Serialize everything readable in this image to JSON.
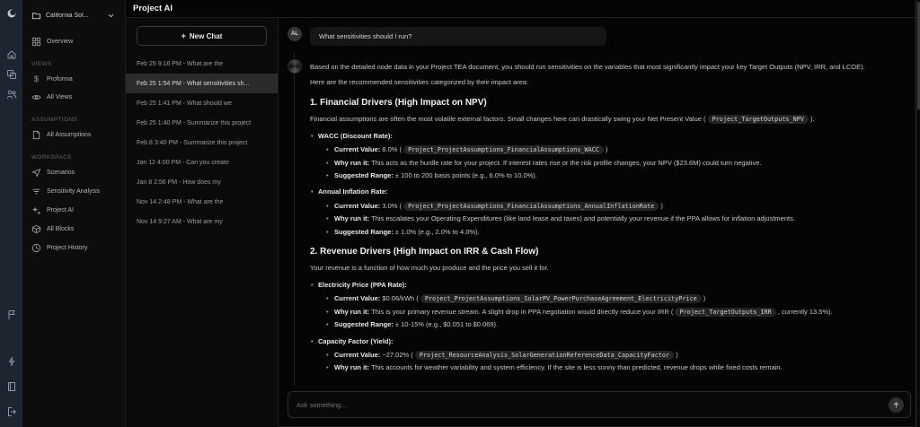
{
  "colors": {
    "rail_bg": "#1d2531",
    "selected_item_bg": "#2b2b2b",
    "chip_bg": "#242424",
    "panel_bg": "#0d0d0d"
  },
  "rail": {
    "top_icons": [
      "logo-icon",
      "home-icon",
      "copy-icon",
      "users-icon"
    ],
    "bottom_icons": [
      "flag-icon",
      "zap-icon",
      "book-icon",
      "logout-icon"
    ]
  },
  "sidebar": {
    "project": {
      "label": "California Sol...",
      "icon": "folder-icon",
      "chevron": "chevron-down-icon"
    },
    "groups": [
      {
        "section": "",
        "items": [
          {
            "label": "Overview",
            "icon": "grid-icon"
          }
        ]
      },
      {
        "section": "VIEWS",
        "items": [
          {
            "label": "Proforma",
            "icon": "dollar-icon"
          },
          {
            "label": "All Views",
            "icon": "eye-icon"
          }
        ]
      },
      {
        "section": "ASSUMPTIONS",
        "items": [
          {
            "label": "All Assumptions",
            "icon": "file-icon"
          }
        ]
      },
      {
        "section": "WORKSPACE",
        "items": [
          {
            "label": "Scenarios",
            "icon": "scenarios-icon"
          },
          {
            "label": "Sensitivity Analysis",
            "icon": "filter-icon"
          },
          {
            "label": "Project AI",
            "icon": "sparkles-icon"
          },
          {
            "label": "All Blocks",
            "icon": "blocks-icon"
          },
          {
            "label": "Project History",
            "icon": "clock-icon"
          }
        ]
      }
    ]
  },
  "header": {
    "title": "Project AI"
  },
  "chat_list": {
    "new_chat": {
      "icon": "plus-icon",
      "label": "New Chat"
    },
    "items": [
      {
        "label": "Feb 25 9:16 PM - What are the",
        "selected": false
      },
      {
        "label": "Feb 25 1:54 PM - What sensitivities sh...",
        "selected": true
      },
      {
        "label": "Feb 25 1:41 PM - What should we",
        "selected": false
      },
      {
        "label": "Feb 25 1:40 PM - Summarize this project",
        "selected": false
      },
      {
        "label": "Feb 8 3:40 PM - Summarize this project",
        "selected": false
      },
      {
        "label": "Jan 12 4:00 PM - Can you create",
        "selected": false
      },
      {
        "label": "Jan 8 2:56 PM - How does my",
        "selected": false
      },
      {
        "label": "Nov 14 2:48 PM - What are the",
        "selected": false
      },
      {
        "label": "Nov 14 9:27 AM - What are my",
        "selected": false
      }
    ]
  },
  "conversation": {
    "user": {
      "avatar_initials": "AL",
      "message": "What sensitivities should I run?"
    },
    "assistant": {
      "blocks": [
        {
          "type": "p",
          "runs": [
            {
              "t": "Based on the detailed node data in your Project TEA document, you should run sensitivities on the variables that most significantly impact your key Target Outputs (NPV, IRR, and LCOE)."
            }
          ]
        },
        {
          "type": "p",
          "runs": [
            {
              "t": "Here are the recommended sensitivities categorized by their impact area:"
            }
          ]
        },
        {
          "type": "h",
          "runs": [
            {
              "t": "1. Financial Drivers (High Impact on NPV)"
            }
          ]
        },
        {
          "type": "p",
          "runs": [
            {
              "t": "Financial assumptions are often the most volatile external factors. Small changes here can drastically swing your Net Present Value ( "
            },
            {
              "c": "Project_TargetOutputs_NPV"
            },
            {
              "t": " )."
            }
          ]
        },
        {
          "type": "li1",
          "runs": [
            {
              "b": "WACC (Discount Rate):"
            }
          ]
        },
        {
          "type": "li2",
          "runs": [
            {
              "b": "Current Value:"
            },
            {
              "t": " 8.0% ( "
            },
            {
              "c": "Project_ProjectAssumptions_FinancialAssumptions_WACC"
            },
            {
              "t": " )"
            }
          ]
        },
        {
          "type": "li2",
          "runs": [
            {
              "b": "Why run it:"
            },
            {
              "t": " This acts as the hurdle rate for your project. If interest rates rise or the risk profile changes, your NPV ($23.6M) could turn negative."
            }
          ]
        },
        {
          "type": "li2",
          "runs": [
            {
              "b": "Suggested Range:"
            },
            {
              "t": " ± 100 to 200 basis points (e.g., 6.0% to 10.0%)."
            }
          ]
        },
        {
          "type": "li1",
          "runs": [
            {
              "b": "Annual Inflation Rate:"
            }
          ]
        },
        {
          "type": "li2",
          "runs": [
            {
              "b": "Current Value:"
            },
            {
              "t": " 3.0% ( "
            },
            {
              "c": "Project_ProjectAssumptions_FinancialAssumptions_AnnualInflationRate"
            },
            {
              "t": " )"
            }
          ]
        },
        {
          "type": "li2",
          "runs": [
            {
              "b": "Why run it:"
            },
            {
              "t": " This escalates your Operating Expenditures (like land lease and taxes) and potentially your revenue if the PPA allows for inflation adjustments."
            }
          ]
        },
        {
          "type": "li2",
          "runs": [
            {
              "b": "Suggested Range:"
            },
            {
              "t": " ± 1.0% (e.g., 2.0% to 4.0%)."
            }
          ]
        },
        {
          "type": "h",
          "runs": [
            {
              "t": "2. Revenue Drivers (High Impact on IRR & Cash Flow)"
            }
          ]
        },
        {
          "type": "p",
          "runs": [
            {
              "t": "Your revenue is a function of how much you produce and the price you sell it for."
            }
          ]
        },
        {
          "type": "li1",
          "runs": [
            {
              "b": "Electricity Price (PPA Rate):"
            }
          ]
        },
        {
          "type": "li2",
          "runs": [
            {
              "b": "Current Value:"
            },
            {
              "t": " $0.06/kWh ( "
            },
            {
              "c": "Project_ProjectAssumptions_SolarPV_PowerPurchaseAgreement_ElectricityPrice"
            },
            {
              "t": " )"
            }
          ]
        },
        {
          "type": "li2",
          "runs": [
            {
              "b": "Why run it:"
            },
            {
              "t": " This is your primary revenue stream. A slight drop in PPA negotiation would directly reduce your IRR ( "
            },
            {
              "c": "Project_TargetOutputs_IRR"
            },
            {
              "t": " , currently 13.5%)."
            }
          ]
        },
        {
          "type": "li2",
          "runs": [
            {
              "b": "Suggested Range:"
            },
            {
              "t": " ± 10-15% (e.g., $0.051 to $0.069)."
            }
          ]
        },
        {
          "type": "li1",
          "runs": [
            {
              "b": "Capacity Factor (Yield):"
            }
          ]
        },
        {
          "type": "li2",
          "runs": [
            {
              "b": "Current Value:"
            },
            {
              "t": " ~27.02% ( "
            },
            {
              "c": "Project_ResourceAnalysis_SolarGenerationReferenceData_CapacityFactor"
            },
            {
              "t": " )"
            }
          ]
        },
        {
          "type": "li2",
          "runs": [
            {
              "b": "Why run it:"
            },
            {
              "t": " This accounts for weather variability and system efficiency. If the site is less sunny than predicted, revenue drops while fixed costs remain."
            }
          ]
        }
      ]
    }
  },
  "composer": {
    "placeholder": "Ask something...",
    "send_icon": "arrow-up-icon"
  }
}
